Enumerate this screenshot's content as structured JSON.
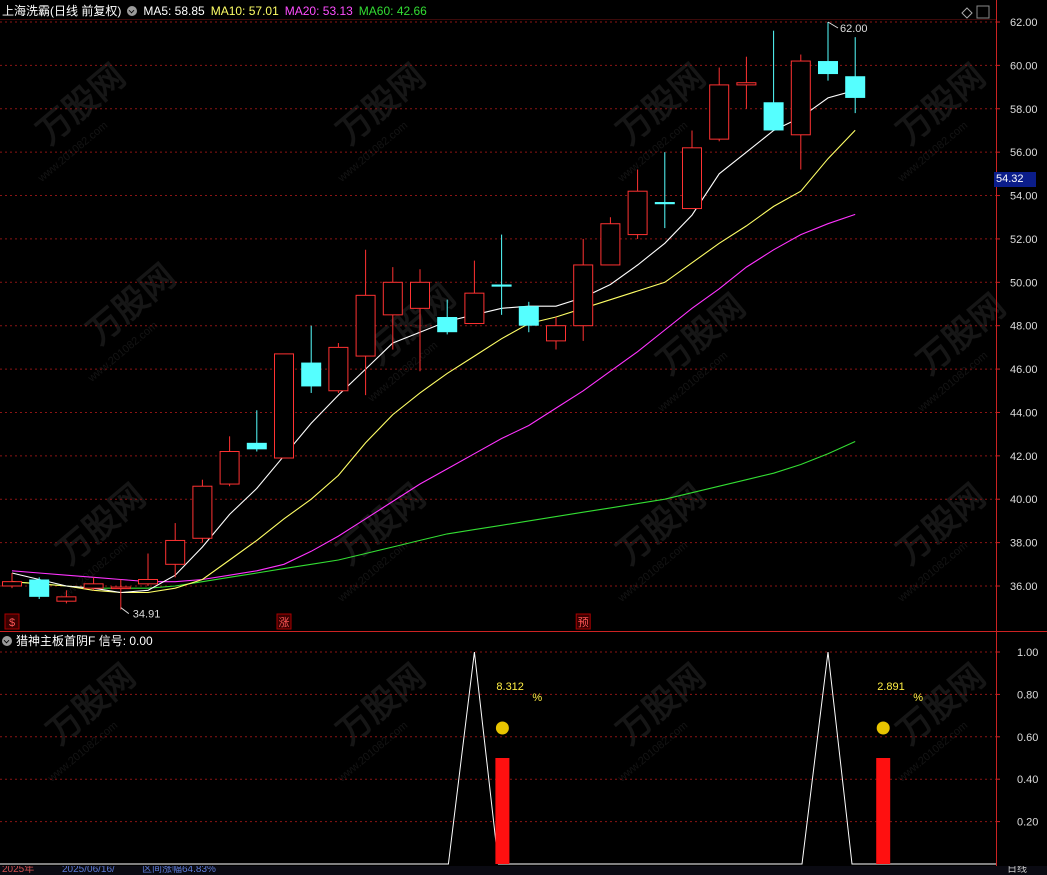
{
  "header": {
    "title": "上海洗霸(日线 前复权)",
    "indicators": [
      {
        "label": "MA5: 58.85",
        "color": "#ffffff"
      },
      {
        "label": "MA10: 57.01",
        "color": "#ffff66"
      },
      {
        "label": "MA20: 53.13",
        "color": "#ff4dff"
      },
      {
        "label": "MA60: 42.66",
        "color": "#33dd33"
      }
    ]
  },
  "sub_header": {
    "title": "猎神主板首阴F",
    "signal": "信号: 0.00"
  },
  "current_price": "54.32",
  "bottom_bar": {
    "year": "2025年",
    "date": "2025/06/16/",
    "info": "区间涨幅64.83%",
    "right": "日线"
  },
  "watermark": {
    "text": "万股网",
    "url": "www.201082.com"
  },
  "markers": [
    "$",
    "涨",
    "预"
  ],
  "colors": {
    "up": "#ff3232",
    "down": "#55ffff",
    "grid": "#8b1414",
    "axis": "#cc2222",
    "bg": "#000000"
  },
  "chart_data": [
    {
      "type": "candlestick",
      "y_ticks": [
        "62.00",
        "60.00",
        "58.00",
        "56.00",
        "54.00",
        "52.00",
        "50.00",
        "48.00",
        "46.00",
        "44.00",
        "42.00",
        "40.00",
        "38.00",
        "36.00"
      ],
      "ylim": [
        35.2,
        62.6
      ],
      "high_label": "62.00",
      "low_label": "34.91",
      "candles": [
        {
          "o": 36.0,
          "c": 36.2,
          "h": 36.6,
          "l": 35.9
        },
        {
          "o": 36.3,
          "c": 35.5,
          "h": 36.4,
          "l": 35.4
        },
        {
          "o": 35.3,
          "c": 35.5,
          "h": 35.8,
          "l": 35.2
        },
        {
          "o": 35.9,
          "c": 36.1,
          "h": 36.4,
          "l": 35.8
        },
        {
          "o": 35.9,
          "c": 35.95,
          "h": 36.3,
          "l": 34.91
        },
        {
          "o": 36.1,
          "c": 36.3,
          "h": 37.5,
          "l": 36.0
        },
        {
          "o": 37.0,
          "c": 38.1,
          "h": 38.9,
          "l": 36.4
        },
        {
          "o": 38.2,
          "c": 40.6,
          "h": 40.9,
          "l": 38.0
        },
        {
          "o": 40.7,
          "c": 42.2,
          "h": 42.9,
          "l": 40.6
        },
        {
          "o": 42.6,
          "c": 42.3,
          "h": 44.1,
          "l": 42.2
        },
        {
          "o": 41.9,
          "c": 46.7,
          "h": 46.7,
          "l": 41.9
        },
        {
          "o": 46.3,
          "c": 45.2,
          "h": 48.0,
          "l": 44.9
        },
        {
          "o": 45.0,
          "c": 47.0,
          "h": 47.2,
          "l": 44.9
        },
        {
          "o": 46.6,
          "c": 49.4,
          "h": 51.5,
          "l": 44.8
        },
        {
          "o": 48.5,
          "c": 50.0,
          "h": 50.7,
          "l": 46.9
        },
        {
          "o": 48.8,
          "c": 50.0,
          "h": 50.6,
          "l": 45.9
        },
        {
          "o": 48.4,
          "c": 47.7,
          "h": 49.2,
          "l": 47.6
        },
        {
          "o": 48.1,
          "c": 49.5,
          "h": 51.0,
          "l": 48.1
        },
        {
          "o": 49.9,
          "c": 49.8,
          "h": 52.2,
          "l": 48.5
        },
        {
          "o": 48.9,
          "c": 48.0,
          "h": 49.1,
          "l": 47.7
        },
        {
          "o": 47.3,
          "c": 48.0,
          "h": 48.4,
          "l": 46.9
        },
        {
          "o": 48.0,
          "c": 50.8,
          "h": 52.0,
          "l": 47.3
        },
        {
          "o": 50.8,
          "c": 52.7,
          "h": 53.0,
          "l": 50.8
        },
        {
          "o": 52.2,
          "c": 54.2,
          "h": 55.2,
          "l": 52.0
        },
        {
          "o": 53.7,
          "c": 53.6,
          "h": 56.0,
          "l": 52.5
        },
        {
          "o": 53.4,
          "c": 56.2,
          "h": 57.0,
          "l": 53.4
        },
        {
          "o": 56.6,
          "c": 59.1,
          "h": 59.9,
          "l": 56.5
        },
        {
          "o": 59.1,
          "c": 59.2,
          "h": 60.4,
          "l": 58.0
        },
        {
          "o": 58.3,
          "c": 57.0,
          "h": 61.6,
          "l": 57.0
        },
        {
          "o": 56.8,
          "c": 60.2,
          "h": 60.5,
          "l": 55.2
        },
        {
          "o": 60.2,
          "c": 59.6,
          "h": 62.0,
          "l": 59.3
        },
        {
          "o": 59.5,
          "c": 58.5,
          "h": 61.3,
          "l": 57.8
        }
      ],
      "ma5": [
        36.6,
        36.3,
        36.0,
        35.9,
        35.7,
        35.8,
        36.5,
        37.8,
        39.3,
        40.5,
        42.0,
        43.5,
        44.8,
        46.0,
        47.2,
        47.7,
        48.2,
        48.5,
        48.8,
        48.9,
        48.9,
        49.3,
        49.9,
        50.8,
        51.8,
        53.1,
        55.0,
        56.0,
        57.0,
        57.6,
        58.5,
        58.85
      ],
      "ma10": [
        36.2,
        36.1,
        36.0,
        35.8,
        35.7,
        35.7,
        35.9,
        36.3,
        37.2,
        38.1,
        39.1,
        40.0,
        41.1,
        42.6,
        43.9,
        44.9,
        45.8,
        46.6,
        47.4,
        48.1,
        48.4,
        48.8,
        49.2,
        49.6,
        50.0,
        50.9,
        51.8,
        52.6,
        53.5,
        54.2,
        55.7,
        57.01
      ],
      "ma20": [
        36.7,
        36.6,
        36.5,
        36.4,
        36.3,
        36.2,
        36.2,
        36.3,
        36.5,
        36.7,
        37.0,
        37.6,
        38.3,
        39.1,
        39.9,
        40.7,
        41.4,
        42.1,
        42.8,
        43.4,
        44.2,
        45.0,
        45.9,
        46.8,
        47.8,
        48.8,
        49.7,
        50.7,
        51.5,
        52.2,
        52.7,
        53.13
      ],
      "ma60": [
        36.2,
        36.1,
        36.0,
        35.9,
        35.9,
        35.9,
        36.0,
        36.2,
        36.4,
        36.6,
        36.8,
        37.0,
        37.2,
        37.5,
        37.8,
        38.1,
        38.4,
        38.6,
        38.8,
        39.0,
        39.2,
        39.4,
        39.6,
        39.8,
        40.0,
        40.3,
        40.6,
        40.9,
        41.2,
        41.6,
        42.1,
        42.66
      ]
    },
    {
      "type": "indicator",
      "title": "猎神主板首阴F",
      "y_ticks": [
        "1.00",
        "0.80",
        "0.60",
        "0.40",
        "0.20"
      ],
      "ylim": [
        0,
        1
      ],
      "signal_line": [
        0,
        0,
        0,
        0,
        0,
        0,
        0,
        0,
        0,
        0,
        0,
        0,
        0,
        0,
        0,
        0,
        0,
        1,
        0,
        0,
        0,
        0,
        0,
        0,
        0,
        0,
        0,
        0,
        0,
        0,
        1,
        0
      ],
      "bars": [
        {
          "index": 17,
          "value": 0.5,
          "pct": "8.312"
        },
        {
          "index": 31,
          "value": 0.5,
          "pct": "2.891"
        }
      ],
      "pct_suffix": "%"
    }
  ]
}
